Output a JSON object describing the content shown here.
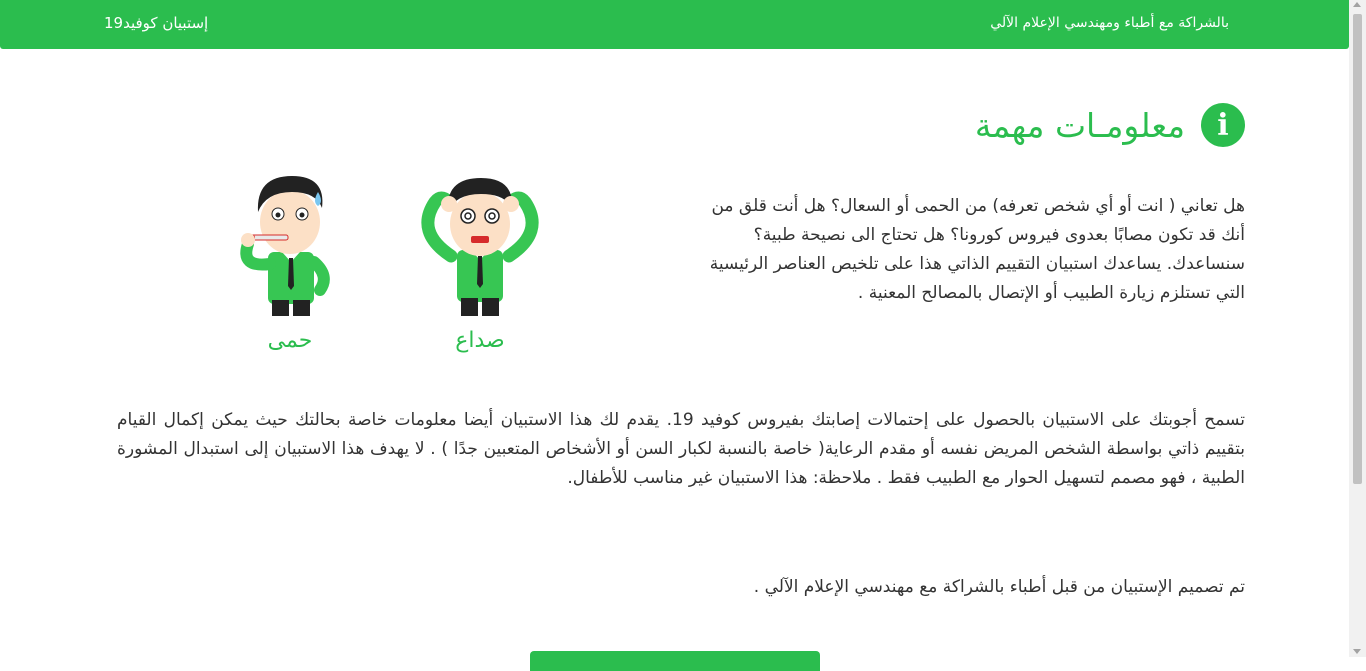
{
  "header": {
    "partner_text": "بالشراكة مع أطباء ومهندسي الإعلام الآلي",
    "brand": "إستبيان كوفيد19"
  },
  "section": {
    "title": "معلومـات مهمة",
    "icon": "info-icon",
    "icon_glyph": "i"
  },
  "intro_text": "هل تعاني ( انت أو أي شخص تعرفه) من الحمى أو السعال؟ هل أنت قلق من أنك قد تكون مصابًا بعدوى فيروس كورونا؟ هل تحتاج الى نصيحة طبية؟ سنساعدك. يساعدك استبيان التقييم الذاتي هذا على تلخيص العناصر الرئيسية التي تستلزم زيارة الطبيب أو الإتصال بالمصالح المعنية .",
  "symptoms": [
    {
      "label": "صداع",
      "icon": "headache-man-illustration"
    },
    {
      "label": "حمى",
      "icon": "fever-man-illustration"
    }
  ],
  "body_text": "تسمح أجوبتك على الاستبيان بالحصول على إحتمالات إصابتك بفيروس كوفيد 19. يقدم لك هذا الاستبيان أيضا معلومات خاصة بحالتك حيث يمكن إكمال القيام بتقييم ذاتي بواسطة الشخص المريض نفسه أو مقدم الرعاية( خاصة بالنسبة لكبار السن أو الأشخاص المتعبين جدًا ) . لا يهدف هذا الاستبيان إلى استبدال المشورة الطبية ، فهو مصمم لتسهيل الحوار مع الطبيب فقط . ملاحظة: هذا الاستبيان غير مناسب للأطفال.",
  "credit_text": "تم تصميم الإستبيان من قبل أطباء بالشراكة مع مهندسي الإعلام الآلي .",
  "colors": {
    "accent": "#2bbd4e",
    "text": "#333333"
  }
}
